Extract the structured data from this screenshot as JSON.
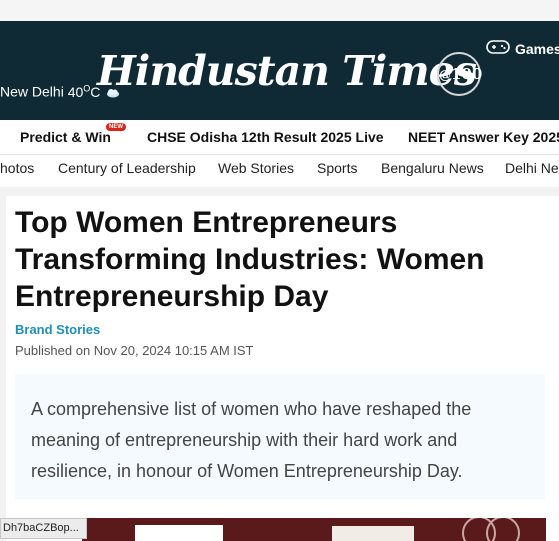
{
  "masthead": {
    "logo": "Hindustan Times",
    "centenary_badge": "100",
    "weather_city": "New Delhi",
    "weather_temp": "40",
    "weather_unit": "O",
    "weather_unit_suffix": "C",
    "games_label": "Games"
  },
  "nav_primary": {
    "items": [
      {
        "label": "Predict & Win",
        "tag": "NEW"
      },
      {
        "label": "CHSE Odisha 12th Result 2025 Live"
      },
      {
        "label": "NEET Answer Key 2025"
      }
    ]
  },
  "nav_secondary": {
    "items": [
      "hotos",
      "Century of Leadership",
      "Web Stories",
      "Sports",
      "Bengaluru News",
      "Delhi Ne"
    ]
  },
  "article": {
    "headline": "Top Women Entrepreneurs Transforming Industries: Women Entrepreneurship Day",
    "category": "Brand Stories",
    "published": "Published on Nov 20, 2024 10:15 AM IST",
    "summary": "A comprehensive list of women who have reshaped the meaning of entrepreneurship with their hard work and resilience, in honour of Women Entrepreneurship Day."
  },
  "status_bar": {
    "url_text": "Dh7baCZBop..."
  },
  "colors": {
    "masthead_bg": "#0f2a35",
    "category_link": "#1e8fb8",
    "new_tag": "#d8241c",
    "summary_bg": "#f4fafd"
  }
}
